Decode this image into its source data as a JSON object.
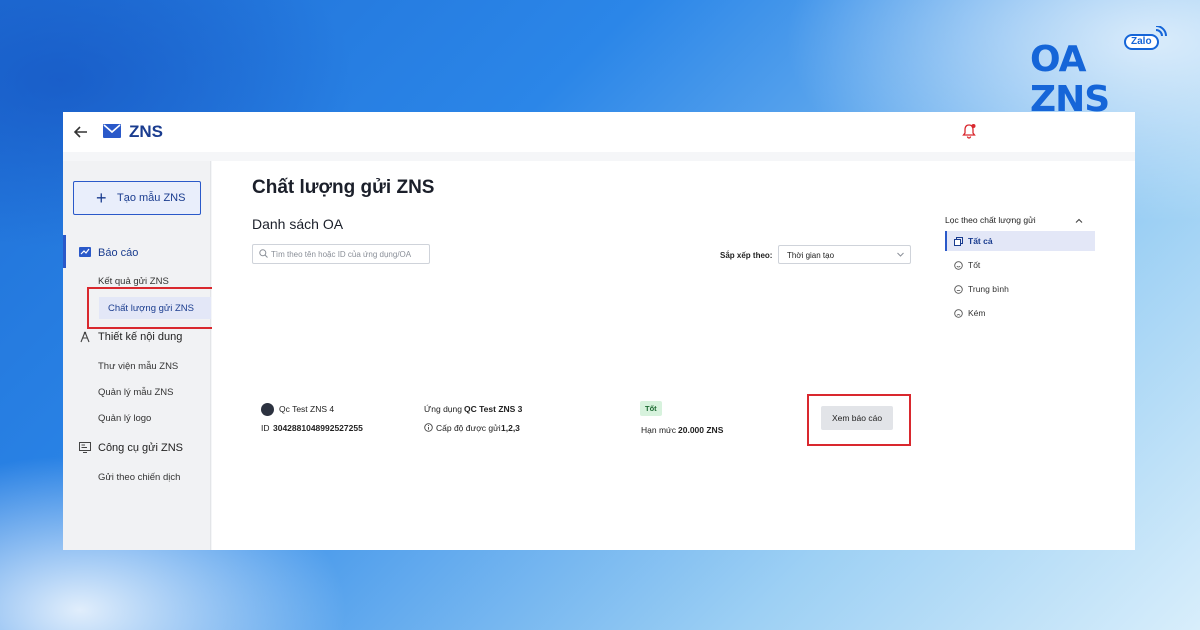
{
  "brand": {
    "text": "OA ZNS",
    "tag": "Zalo"
  },
  "topbar": {
    "title": "ZNS"
  },
  "sidebar": {
    "create_label": "Tạo mẫu ZNS",
    "sections": [
      {
        "label": "Báo cáo",
        "items": [
          "Kết quả gửi ZNS",
          "Chất lượng gửi ZNS"
        ]
      },
      {
        "label": "Thiết kế nội dung",
        "items": [
          "Thư viện mẫu ZNS",
          "Quản lý mẫu ZNS",
          "Quản lý logo"
        ]
      },
      {
        "label": "Công cụ gửi ZNS",
        "items": [
          "Gửi theo chiến dịch"
        ]
      }
    ]
  },
  "main": {
    "title": "Chất lượng gửi ZNS",
    "list_title": "Danh sách OA",
    "search_placeholder": "Tìm theo tên hoặc ID của ứng dụng/OA",
    "sort_label": "Sắp xếp theo:",
    "sort_value": "Thời gian tạo"
  },
  "filter": {
    "title": "Lọc theo chất lượng gửi",
    "options": [
      "Tất cả",
      "Tốt",
      "Trung bình",
      "Kém"
    ],
    "active": "Tất cả"
  },
  "row": {
    "oa_name": "Qc Test ZNS 4",
    "id_label": "ID",
    "id_value": "3042881048992527255",
    "app_label": "Ứng dụng",
    "app_name": "QC Test ZNS 3",
    "level_label": "Cấp độ được gửi",
    "level_value": "1,2,3",
    "quality_badge": "Tốt",
    "limit_label": "Hạn mức",
    "limit_value": "20.000 ZNS",
    "view_button": "Xem báo cáo"
  },
  "colors": {
    "accent": "#2a59c9",
    "title_navy": "#1a3c8f",
    "highlight_red": "#d9282e",
    "badge_good_bg": "#d7f2dd",
    "brand_blue": "#1565d8"
  }
}
